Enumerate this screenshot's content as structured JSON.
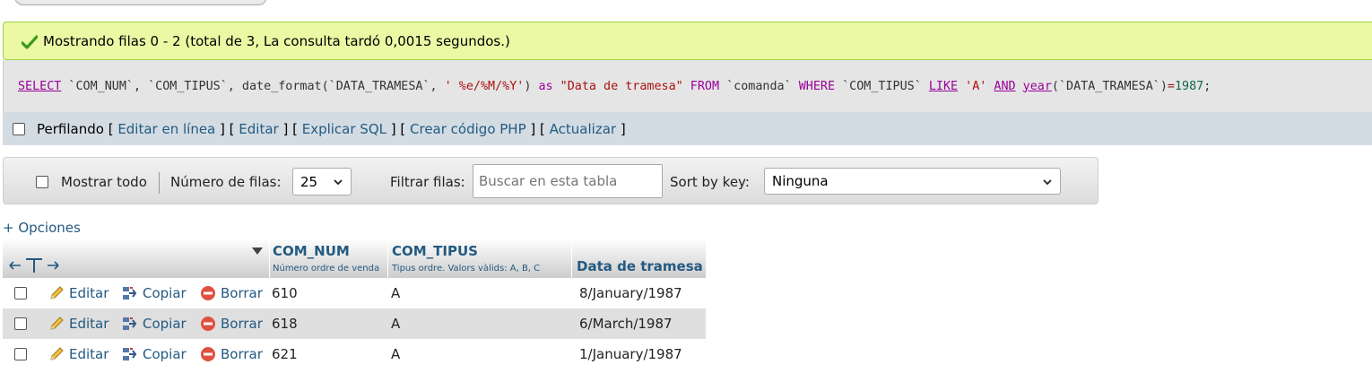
{
  "message": {
    "text": "Mostrando filas 0 - 2 (total de 3, La consulta tardó 0,0015 segundos.)",
    "icon": "check-icon",
    "color": "#ebf8a4"
  },
  "sql": {
    "query": "SELECT `COM_NUM`, `COM_TIPUS`, date_format(`DATA_TRAMESA`, ' %e/%M/%Y') as \"Data de tramesa\" FROM `comanda` WHERE `COM_TIPUS` LIKE 'A' AND year(`DATA_TRAMESA`)=1987;",
    "tokens": {
      "select": "SELECT",
      "col1": " `COM_NUM`, `COM_TIPUS`, date_format(`DATA_TRAMESA`, ",
      "fmt": "' %e/%M/%Y'",
      "close": ") ",
      "as": "as",
      "alias": " \"Data de tramesa\" ",
      "from": "FROM",
      "table": " `comanda` ",
      "where": "WHERE",
      "col2": " `COM_TIPUS` ",
      "like": "LIKE",
      "val": " 'A' ",
      "and": "AND",
      "sp": " ",
      "year": "year",
      "col3": "(`DATA_TRAMESA`)",
      "eq": "=",
      "num": "1987",
      "end": ";"
    }
  },
  "profiling": {
    "label": "Perfilando",
    "links": [
      "Editar en línea",
      "Editar",
      "Explicar SQL",
      "Crear código PHP",
      "Actualizar"
    ]
  },
  "toolbar": {
    "show_all": "Mostrar todo",
    "rows_label": "Número de filas:",
    "rows_value": "25",
    "filter_label": "Filtrar filas:",
    "search_placeholder": "Buscar en esta tabla",
    "sort_label": "Sort by key:",
    "sort_value": "Ninguna"
  },
  "options_link": "+ Opciones",
  "table": {
    "columns": [
      {
        "name": "COM_NUM",
        "desc": "Número ordre de venda"
      },
      {
        "name": "COM_TIPUS",
        "desc": "Tipus ordre. Valors vàlids: A, B, C"
      },
      {
        "name": "Data de tramesa",
        "desc": ""
      }
    ],
    "actions": {
      "edit": "Editar",
      "copy": "Copiar",
      "delete": "Borrar"
    },
    "rows": [
      {
        "com_num": "610",
        "com_tipus": "A",
        "data": "8/January/1987"
      },
      {
        "com_num": "618",
        "com_tipus": "A",
        "data": "6/March/1987"
      },
      {
        "com_num": "621",
        "com_tipus": "A",
        "data": "1/January/1987"
      }
    ]
  },
  "colors": {
    "link": "#235a81",
    "profbar": "#d3dce3",
    "success_border": "#a2d246"
  }
}
